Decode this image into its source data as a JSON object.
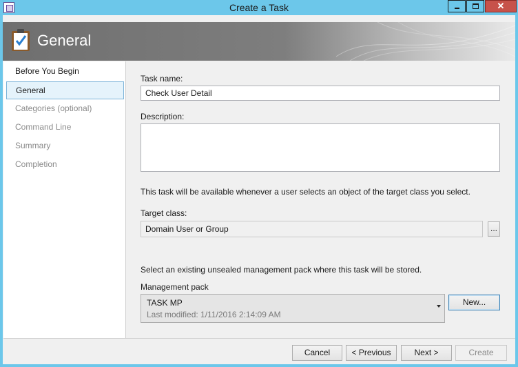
{
  "window": {
    "title": "Create a Task",
    "close_glyph": "✕"
  },
  "header": {
    "title": "General",
    "icon": "clipboard-check-icon"
  },
  "nav": {
    "items": [
      {
        "label": "Before You Begin",
        "state": "normal"
      },
      {
        "label": "General",
        "state": "selected"
      },
      {
        "label": "Categories (optional)",
        "state": "disabled"
      },
      {
        "label": "Command Line",
        "state": "disabled"
      },
      {
        "label": "Summary",
        "state": "disabled"
      },
      {
        "label": "Completion",
        "state": "disabled"
      }
    ]
  },
  "form": {
    "task_name_label": "Task name:",
    "task_name_value": "Check User Detail",
    "description_label": "Description:",
    "description_value": "",
    "info_text": "This task will be available whenever a user selects an object of the target class you select.",
    "target_class_label": "Target class:",
    "target_class_value": "Domain User or Group",
    "browse_label": "...",
    "mp_info_text": "Select an existing unsealed management pack where this task will be stored.",
    "mp_label": "Management pack",
    "mp_name": "TASK MP",
    "mp_modified": "Last modified:  1/11/2016 2:14:09 AM",
    "new_label": "New..."
  },
  "footer": {
    "cancel": "Cancel",
    "previous": "< Previous",
    "next": "Next >",
    "create": "Create"
  },
  "colors": {
    "titlebar": "#6cc7ea",
    "close": "#c7524a",
    "selection": "#e5f3fb",
    "selection_border": "#7db4d9"
  }
}
